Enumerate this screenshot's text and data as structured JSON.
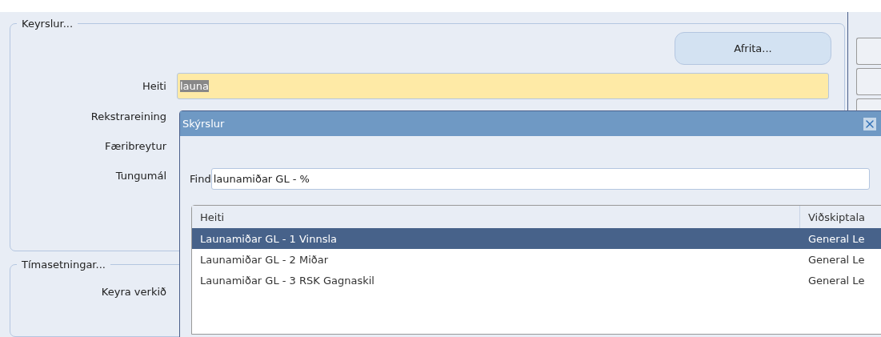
{
  "runs_group": {
    "legend": "Keyrslur...",
    "copy_button": "Afrita...",
    "fields": [
      {
        "label": "Heiti",
        "value": "launa",
        "focused": true
      },
      {
        "label": "Rekstrareining"
      },
      {
        "label": "Færibreytur"
      },
      {
        "label": "Tungumál"
      }
    ]
  },
  "schedule_group": {
    "legend": "Tímasetningar...",
    "fields": [
      {
        "label": "Keyra verkið"
      }
    ]
  },
  "dialog": {
    "title": "Skýrslur",
    "find_label": "Find",
    "find_value": "launamiðar GL - %",
    "columns": [
      "Heiti",
      "Viðskiptala"
    ],
    "rows": [
      {
        "cells": [
          "Launamiðar GL - 1 Vinnsla",
          "General Le"
        ],
        "selected": true
      },
      {
        "cells": [
          "Launamiðar GL - 2 Miðar",
          "General Le"
        ],
        "selected": false
      },
      {
        "cells": [
          "Launamiðar GL - 3 RSK Gagnaskil",
          "General Le"
        ],
        "selected": false
      }
    ]
  }
}
